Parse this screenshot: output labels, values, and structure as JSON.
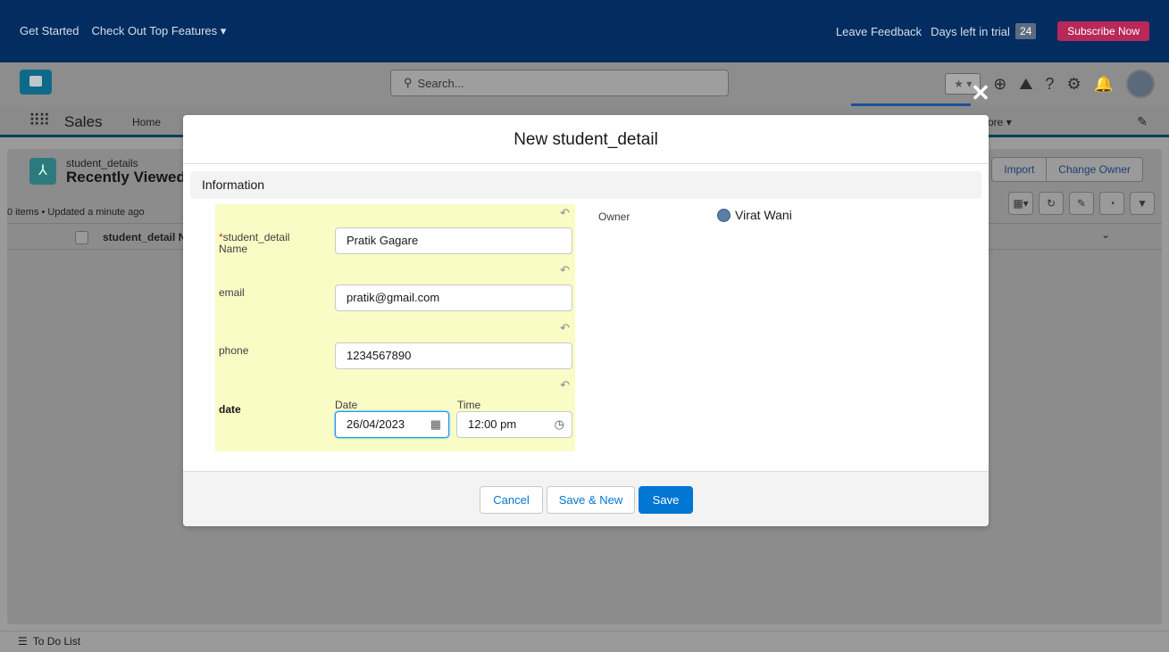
{
  "trial_bar": {
    "get_started": "Get Started",
    "top_features": "Check Out Top Features",
    "leave_feedback": "Leave Feedback",
    "days_left_label": "Days left in trial",
    "days_left": "24",
    "subscribe": "Subscribe Now"
  },
  "header": {
    "search_placeholder": "Search..."
  },
  "nav": {
    "app_name": "Sales",
    "home": "Home",
    "more": "ore"
  },
  "list": {
    "object_label": "student_details",
    "view_name": "Recently Viewed",
    "meta": "0 items • Updated a minute ago",
    "column_name": "student_detail N",
    "import": "Import",
    "change_owner": "Change Owner"
  },
  "todo": {
    "label": "To Do List"
  },
  "modal": {
    "title": "New student_detail",
    "section": "Information",
    "fields": {
      "name_label_1": "student_detail",
      "name_label_2": "Name",
      "name_value": "Pratik Gagare",
      "email_label": "email",
      "email_value": "pratik@gmail.com",
      "phone_label": "phone",
      "phone_value": "1234567890",
      "date_label": "date",
      "date_sublabel": "Date",
      "time_sublabel": "Time",
      "date_value": "26/04/2023",
      "time_value": "12:00 pm"
    },
    "owner_label": "Owner",
    "owner_value": "Virat Wani",
    "buttons": {
      "cancel": "Cancel",
      "save_new": "Save & New",
      "save": "Save"
    }
  },
  "colors": {
    "trial_bar": "#032d60",
    "subscribe": "#b8285a",
    "brand": "#0176d3",
    "highlight": "#fafcc6"
  }
}
